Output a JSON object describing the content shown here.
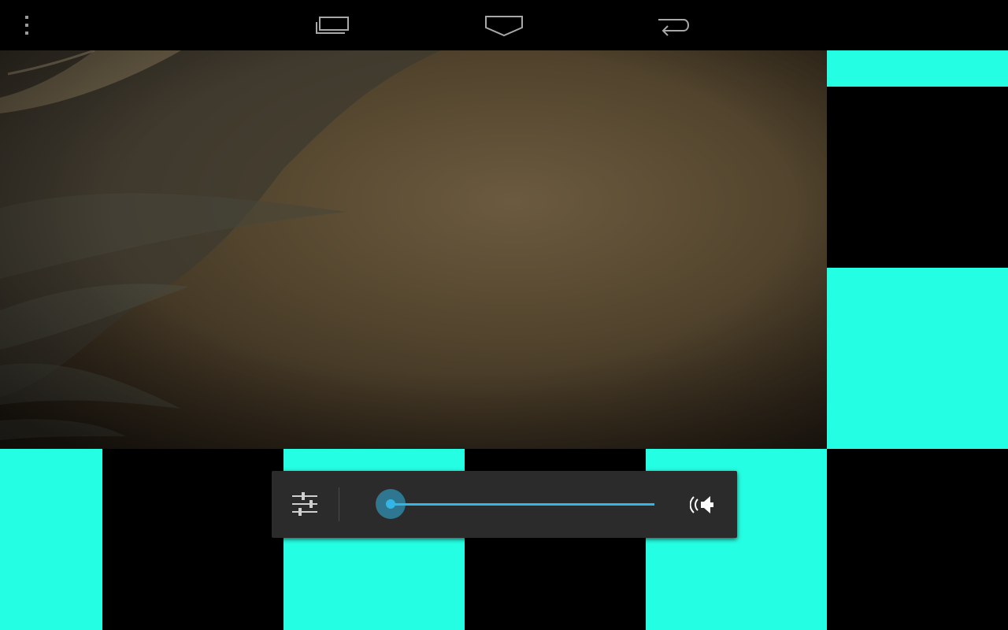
{
  "navbar": {
    "icons": [
      "overflow-menu-icon",
      "recent-apps-icon",
      "home-icon",
      "back-icon"
    ]
  },
  "volume_panel": {
    "level_fraction": 0.0,
    "accent_color": "#33b5e5",
    "icons": [
      "equalizer-settings-icon",
      "speaker-icon"
    ]
  },
  "colors": {
    "tile_cyan": "#24ffe3",
    "tile_black": "#000000",
    "panel_bg": "#2b2b2b"
  }
}
